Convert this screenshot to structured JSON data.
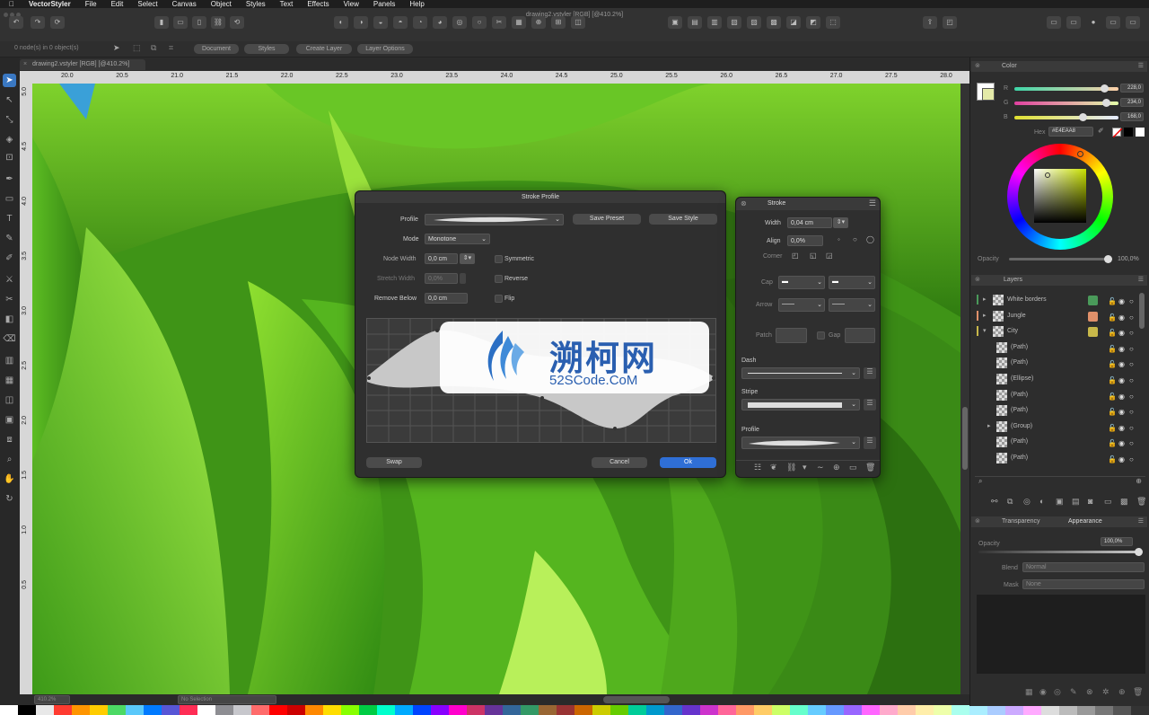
{
  "menu": {
    "app": "VectorStyler",
    "items": [
      "File",
      "Edit",
      "Select",
      "Canvas",
      "Object",
      "Styles",
      "Text",
      "Effects",
      "View",
      "Panels",
      "Help"
    ]
  },
  "window": {
    "title": "drawing2.vstyler [RGB] [@410.2%]"
  },
  "subbar": {
    "status": "0 node(s) in 0 object(s)",
    "buttons": [
      "Document",
      "Styles",
      "Create Layer",
      "Layer Options"
    ]
  },
  "doc_tab": {
    "label": "drawing2.vstyler [RGB] [@410.2%]"
  },
  "ruler": {
    "top": [
      "20.0",
      "20.5",
      "21.0",
      "21.5",
      "22.0",
      "22.5",
      "23.0",
      "23.5",
      "24.0",
      "24.5",
      "25.0",
      "25.5",
      "26.0",
      "26.5",
      "27.0",
      "27.5",
      "28.0"
    ],
    "left": [
      "5.0",
      "4.5",
      "4.0",
      "3.5",
      "3.0",
      "2.5",
      "2.0",
      "1.5",
      "1.0",
      "0.5"
    ]
  },
  "stroke_profile": {
    "title": "Stroke Profile",
    "profile_label": "Profile",
    "save_preset": "Save Preset",
    "save_style": "Save Style",
    "mode_label": "Mode",
    "mode_value": "Monotone",
    "node_width_label": "Node Width",
    "node_width_value": "0,0 cm",
    "symmetric": "Symmetric",
    "stretch_width_label": "Stretch Width",
    "stretch_width_value": "0,0%",
    "reverse": "Reverse",
    "remove_below_label": "Remove Below",
    "remove_below_value": "0,0 cm",
    "flip": "Flip",
    "swap": "Swap",
    "cancel": "Cancel",
    "ok": "Ok"
  },
  "watermark": {
    "cn": "溯柯网",
    "en": "52SCode.CoM"
  },
  "stroke_panel": {
    "tab": "Stroke",
    "width_label": "Width",
    "width_value": "0,04 cm",
    "align_label": "Align",
    "align_value": "0,0%",
    "corner_label": "Corner",
    "cap_label": "Cap",
    "arrow_label": "Arrow",
    "patch_label": "Patch",
    "gap_label": "Gap",
    "dash_label": "Dash",
    "stripe_label": "Stripe",
    "profile_label": "Profile"
  },
  "color_panel": {
    "tab": "Color",
    "r_label": "R",
    "r_value": "228,0",
    "g_label": "G",
    "g_value": "234,0",
    "b_label": "B",
    "b_value": "168,0",
    "hex_label": "Hex",
    "hex_value": "#E4EAA8",
    "opacity_label": "Opacity",
    "opacity_value": "100,0%",
    "fill_color": "#E4EAA8"
  },
  "layers_panel": {
    "tab": "Layers",
    "rows": [
      {
        "name": "White borders",
        "color": "#4a9a5a",
        "top": true
      },
      {
        "name": "Jungle",
        "color": "#e0906a",
        "top": true
      },
      {
        "name": "City",
        "color": "#c8b84a",
        "top": true
      },
      {
        "name": "(Path)"
      },
      {
        "name": "(Path)"
      },
      {
        "name": "(Ellipse)"
      },
      {
        "name": "(Path)"
      },
      {
        "name": "(Path)"
      },
      {
        "name": "(Group)"
      },
      {
        "name": "(Path)"
      },
      {
        "name": "(Path)"
      }
    ]
  },
  "transparency_panel": {
    "tab": "Transparency",
    "tab2": "Appearance",
    "opacity_label": "Opacity",
    "opacity_value": "100,0%",
    "blend_label": "Blend",
    "blend_value": "Normal",
    "mask_label": "Mask",
    "mask_value": "None"
  },
  "bottom": {
    "zoom": "410.2%",
    "selection": "No Selection"
  },
  "palette": [
    "#ffffff",
    "#000000",
    "#e8e8e8",
    "#ff3b30",
    "#ff9500",
    "#ffcc00",
    "#4cd964",
    "#5ac8fa",
    "#007aff",
    "#5856d6",
    "#ff2d55",
    "#ffffff",
    "#8e8e93",
    "#c7c7cc",
    "#ff6b6b",
    "#ff0000",
    "#cc0000",
    "#ff8800",
    "#ffdd00",
    "#88ff00",
    "#00cc44",
    "#00ffcc",
    "#00aaff",
    "#0044ff",
    "#8800ff",
    "#ff00cc",
    "#cc3366",
    "#663399",
    "#336699",
    "#339966",
    "#996633",
    "#993333",
    "#cc6600",
    "#cccc00",
    "#66cc00",
    "#00cc99",
    "#0099cc",
    "#3366cc",
    "#6633cc",
    "#cc33cc",
    "#ff6699",
    "#ff9966",
    "#ffcc66",
    "#ccff66",
    "#66ffcc",
    "#66ccff",
    "#6699ff",
    "#9966ff",
    "#ff66ff",
    "#ffaacc",
    "#ffccaa",
    "#ffeeaa",
    "#eeffaa",
    "#aaffee",
    "#aaeeff",
    "#aaccff",
    "#ccaaff",
    "#ffaaff",
    "#dddddd",
    "#bbbbbb",
    "#999999",
    "#777777",
    "#555555",
    "#333333"
  ]
}
